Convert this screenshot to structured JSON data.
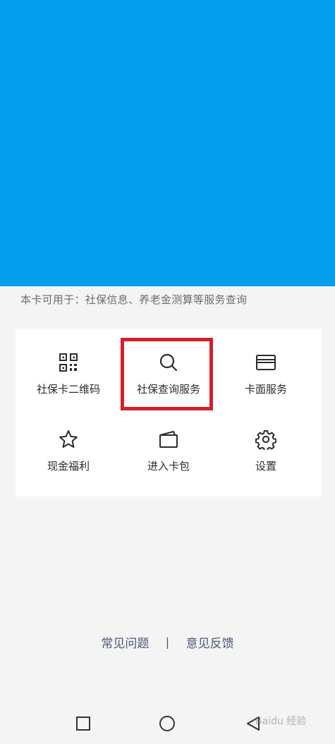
{
  "usage_text": "本卡可用于：社保信息、养老金测算等服务查询",
  "services": [
    {
      "label": "社保卡二维码",
      "icon": "qr-code-icon"
    },
    {
      "label": "社保查询服务",
      "icon": "search-icon"
    },
    {
      "label": "卡面服务",
      "icon": "card-icon"
    },
    {
      "label": "现金福利",
      "icon": "star-icon"
    },
    {
      "label": "进入卡包",
      "icon": "wallet-icon"
    },
    {
      "label": "设置",
      "icon": "gear-icon"
    }
  ],
  "footer": {
    "faq": "常见问题",
    "separator": "|",
    "feedback": "意见反馈"
  },
  "watermark": "Baidu 经验",
  "colors": {
    "banner": "#02a0ec",
    "highlight": "#d3202a",
    "footer_link": "#4b5876"
  }
}
